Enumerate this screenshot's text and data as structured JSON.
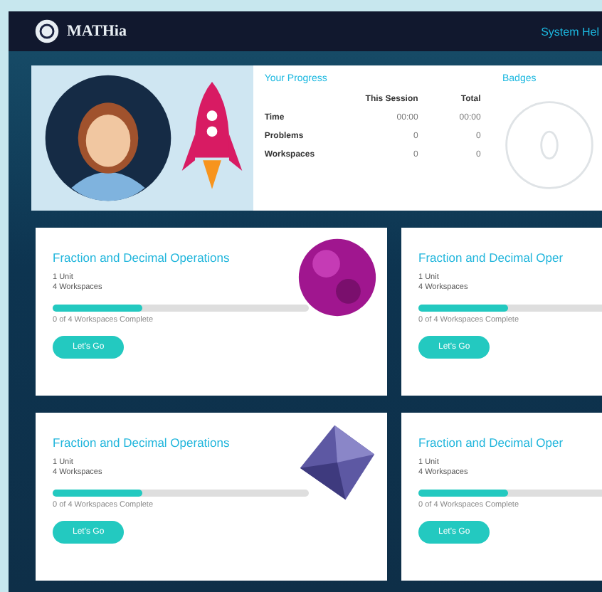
{
  "header": {
    "logo": "MATHia",
    "link": "System Hel"
  },
  "progress": {
    "title": "Your Progress",
    "columns": [
      "This Session",
      "Total"
    ],
    "rows": [
      {
        "label": "Time",
        "values": [
          "00:00",
          "00:00"
        ]
      },
      {
        "label": "Problems",
        "values": [
          "0",
          "0"
        ]
      },
      {
        "label": "Workspaces",
        "values": [
          "0",
          "0"
        ]
      }
    ]
  },
  "badges": {
    "title": "Badges"
  },
  "cards": [
    {
      "title": "Fraction and Decimal Operations",
      "units": "1 Unit",
      "workspaces": "4 Workspaces",
      "level": 0.35,
      "status": "0 of 4 Workspaces Complete",
      "button": "Let's Go",
      "kind": "planet"
    },
    {
      "title": "Fraction and Decimal Oper",
      "units": "1 Unit",
      "workspaces": "4 Workspaces",
      "level": 0.35,
      "status": "0 of 4 Workspaces Complete",
      "button": "Let's Go",
      "kind": "plain"
    },
    {
      "title": "Fraction and Decimal Operations",
      "units": "1 Unit",
      "workspaces": "4 Workspaces",
      "level": 0.35,
      "status": "0 of 4 Workspaces Complete",
      "button": "Let's Go",
      "kind": "crystal"
    },
    {
      "title": "Fraction and Decimal Oper",
      "units": "1 Unit",
      "workspaces": "4 Workspaces",
      "level": 0.35,
      "status": "0 of 4 Workspaces Complete",
      "button": "Let's Go",
      "kind": "plain"
    }
  ]
}
